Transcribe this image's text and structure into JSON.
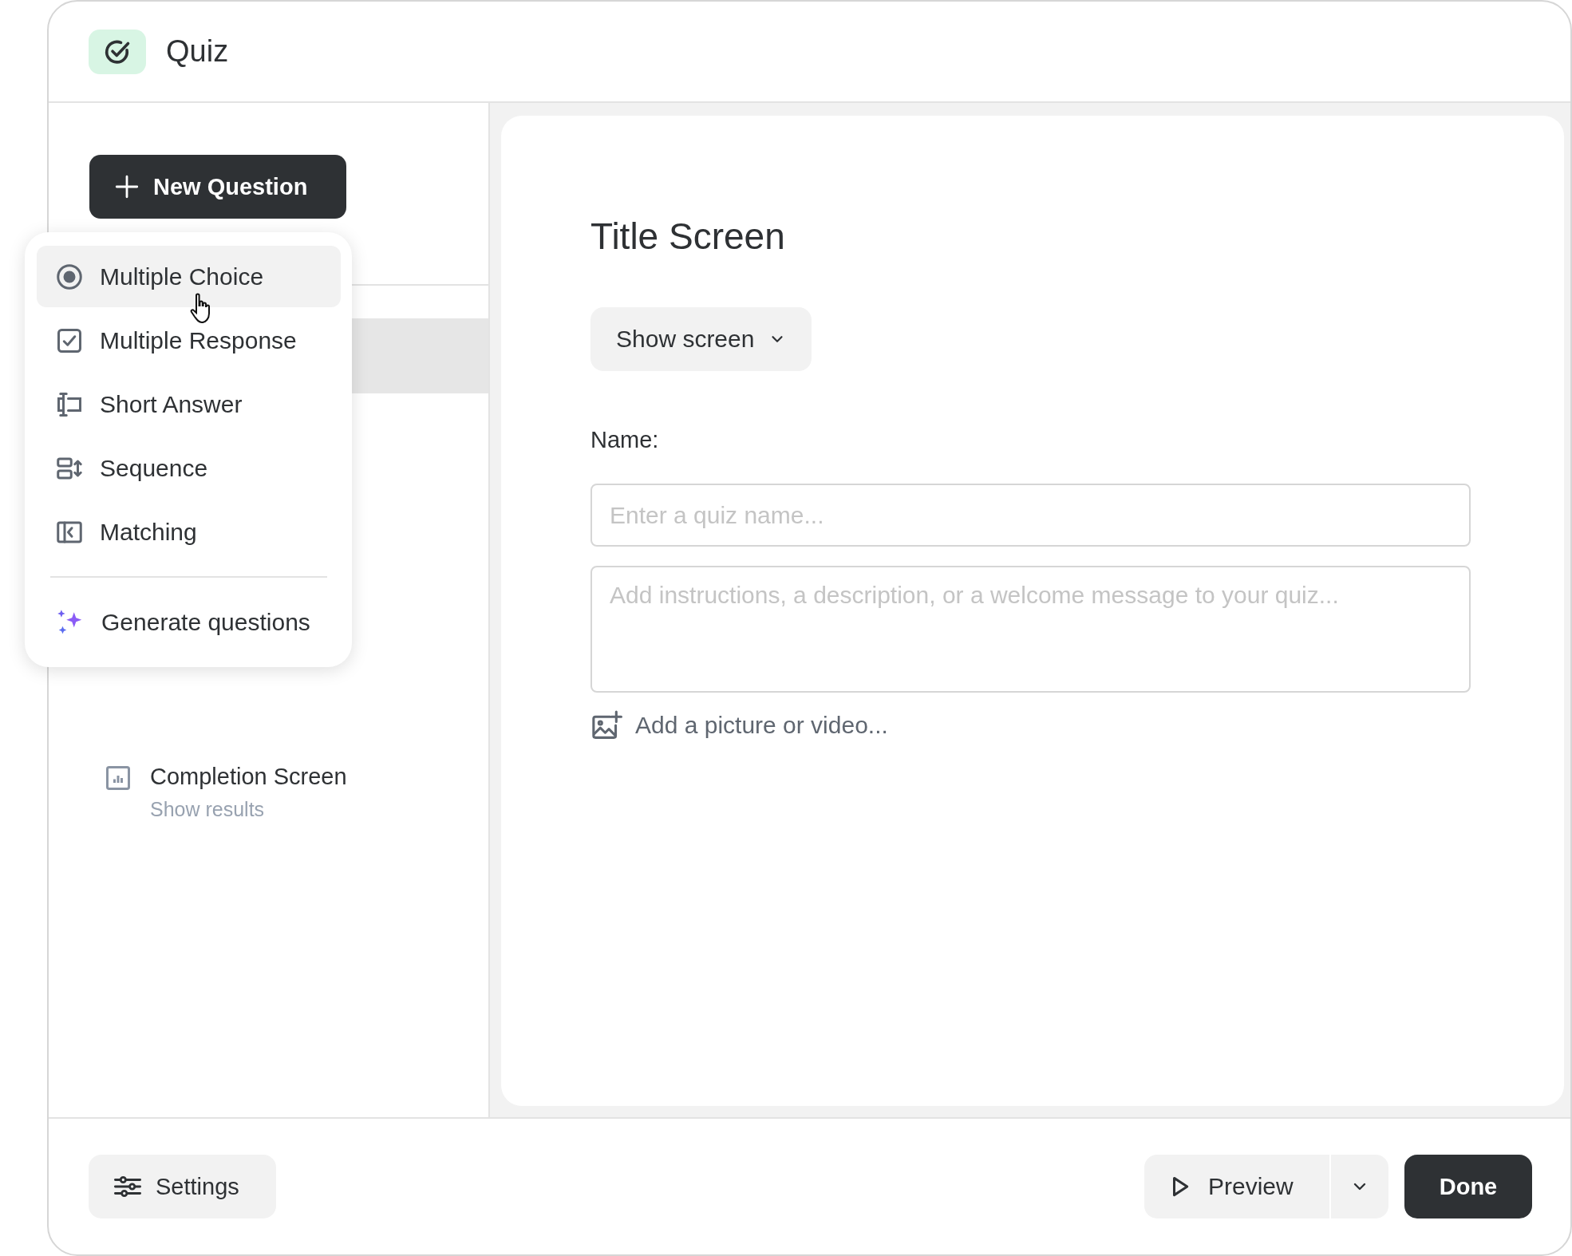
{
  "header": {
    "title": "Quiz"
  },
  "sidebar": {
    "new_button": "New Question",
    "completion": {
      "title": "Completion Screen",
      "subtitle": "Show results"
    }
  },
  "menu": {
    "items": [
      {
        "kind": "radio",
        "label": "Multiple Choice",
        "selected": true
      },
      {
        "kind": "checkbox",
        "label": "Multiple Response",
        "selected": false
      },
      {
        "kind": "text",
        "label": "Short Answer",
        "selected": false
      },
      {
        "kind": "sequence",
        "label": "Sequence",
        "selected": false
      },
      {
        "kind": "matching",
        "label": "Matching",
        "selected": false
      }
    ],
    "generate": "Generate questions"
  },
  "editor": {
    "heading": "Title Screen",
    "visibility": "Show screen",
    "name_label": "Name:",
    "name_placeholder": "Enter a quiz name...",
    "description_placeholder": "Add instructions, a description, or a welcome message to your quiz...",
    "media_link": "Add a picture or video..."
  },
  "footer": {
    "settings": "Settings",
    "preview": "Preview",
    "done": "Done"
  }
}
